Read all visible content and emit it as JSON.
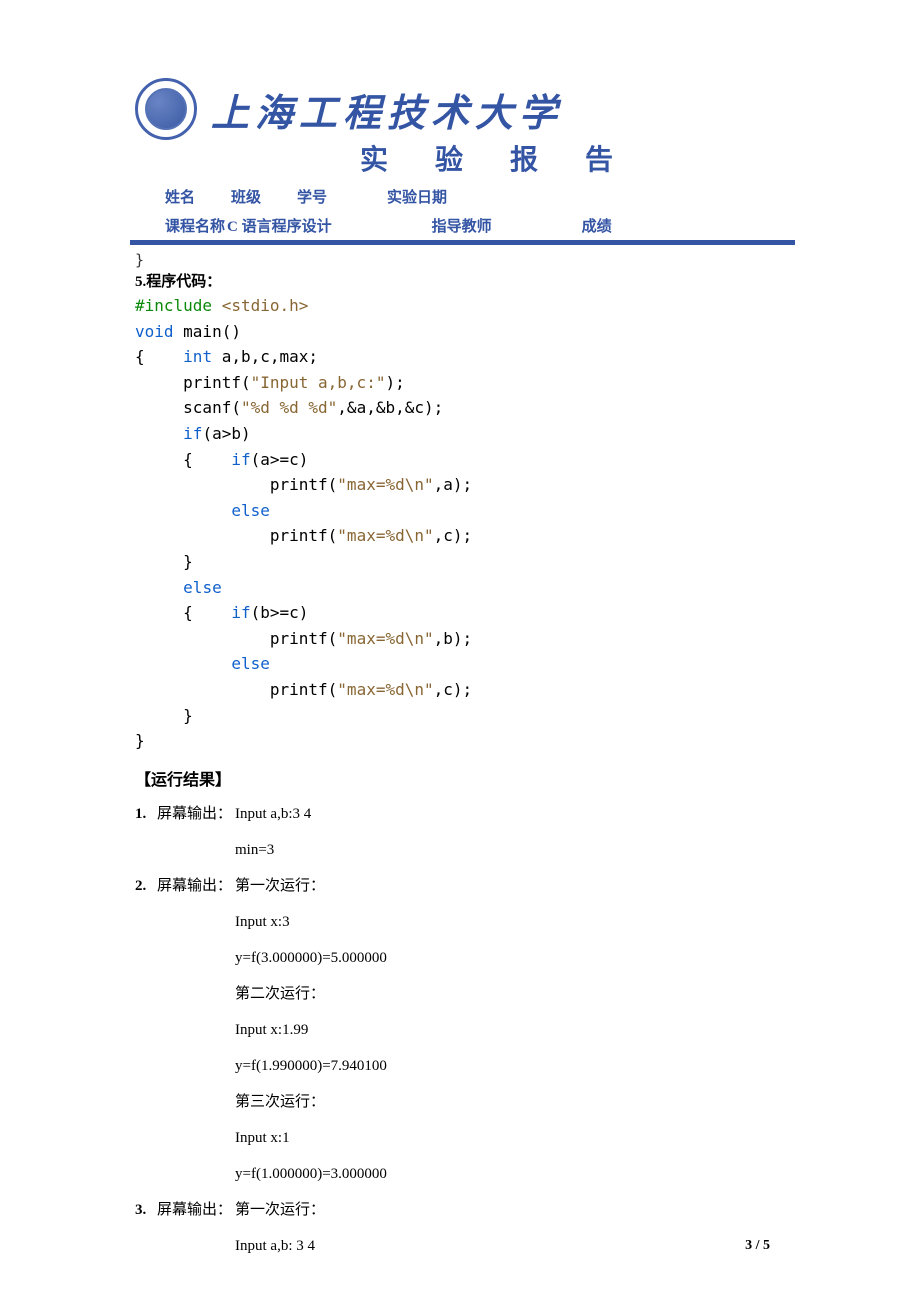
{
  "header": {
    "university": "上海工程技术大学",
    "report_title": "实 验 报 告",
    "row1": {
      "name_label": "姓名",
      "class_label": "班级",
      "id_label": "学号",
      "date_label": "实验日期"
    },
    "row2": {
      "course_label": "课程名称",
      "course_value": "C 语言程序设计",
      "teacher_label": "指导教师",
      "grade_label": "成绩"
    }
  },
  "pre_brace": "}",
  "section_title": "5.程序代码：",
  "code": {
    "l1a": "#include",
    "l1b": " <stdio.h>",
    "l2a": "void",
    "l2b": " main()",
    "l3a": "{    ",
    "l3b": "int",
    "l3c": " a,b,c,max;",
    "l4a": "     printf(",
    "l4b": "\"Input a,b,c:\"",
    "l4c": ");",
    "l5a": "     scanf(",
    "l5b": "\"%d %d %d\"",
    "l5c": ",&a,&b,&c);",
    "l6a": "     ",
    "l6b": "if",
    "l6c": "(a>b)",
    "l7a": "     {    ",
    "l7b": "if",
    "l7c": "(a>=c)",
    "l8a": "              printf(",
    "l8b": "\"max=%d\\n\"",
    "l8c": ",a);",
    "l9a": "          ",
    "l9b": "else",
    "l10a": "              printf(",
    "l10b": "\"max=%d\\n\"",
    "l10c": ",c);",
    "l11": "     }",
    "l12a": "     ",
    "l12b": "else",
    "l13a": "     {    ",
    "l13b": "if",
    "l13c": "(b>=c)",
    "l14a": "              printf(",
    "l14b": "\"max=%d\\n\"",
    "l14c": ",b);",
    "l15a": "          ",
    "l15b": "else",
    "l16a": "              printf(",
    "l16b": "\"max=%d\\n\"",
    "l16c": ",c);",
    "l17": "     }",
    "l18": "}"
  },
  "result_title": "【运行结果】",
  "results": {
    "r1": {
      "num": "1.",
      "label": "屏幕输出：",
      "line1": "Input a,b:3 4",
      "line2": "min=3"
    },
    "r2": {
      "num": "2.",
      "label": "屏幕输出：",
      "l1": "第一次运行：",
      "l2": "Input x:3",
      "l3": "y=f(3.000000)=5.000000",
      "l4": "第二次运行：",
      "l5": "Input x:1.99",
      "l6": "y=f(1.990000)=7.940100",
      "l7": "第三次运行：",
      "l8": "Input x:1",
      "l9": "y=f(1.000000)=3.000000"
    },
    "r3": {
      "num": "3.",
      "label": "屏幕输出：",
      "l1": "第一次运行：",
      "l2": "Input a,b: 3 4"
    }
  },
  "page_num": "3 / 5"
}
